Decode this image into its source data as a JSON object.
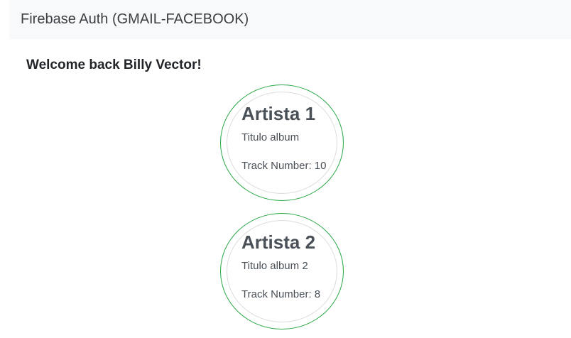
{
  "navbar": {
    "brand": "Firebase Auth (GMAIL-FACEBOOK)"
  },
  "welcome": {
    "text": "Welcome back Billy Vector!"
  },
  "albums": [
    {
      "artist": "Artista 1",
      "title": "Titulo album",
      "track": "Track Number: 10"
    },
    {
      "artist": "Artista 2",
      "title": "Titulo album 2",
      "track": "Track Number: 8"
    }
  ],
  "colors": {
    "card_border": "#28a745",
    "inner_border": "#dcdcdc",
    "navbar_bg": "#f8f9fa"
  }
}
